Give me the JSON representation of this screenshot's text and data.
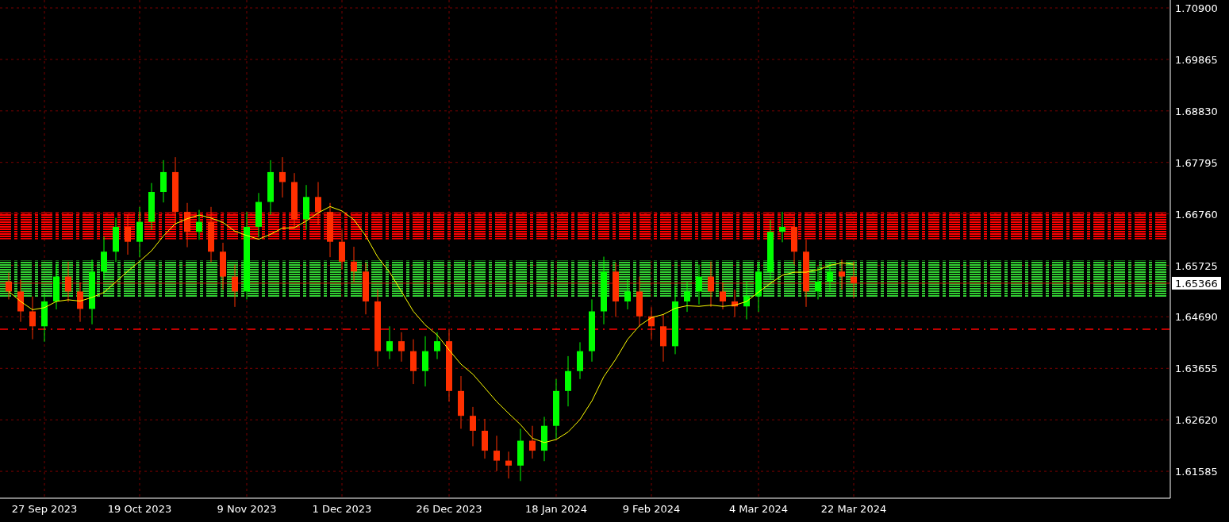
{
  "price_axis": {
    "labels": [
      "1.70900",
      "1.69865",
      "1.68830",
      "1.67795",
      "1.66760",
      "1.65725",
      "1.64690",
      "1.63655",
      "1.62620",
      "1.61585"
    ],
    "current_price": "1.65366"
  },
  "time_axis": {
    "labels": [
      "27 Sep 2023",
      "19 Oct 2023",
      "9 Nov 2023",
      "1 Dec 2023",
      "26 Dec 2023",
      "18 Jan 2024",
      "9 Feb 2024",
      "4 Mar 2024",
      "22 Mar 2024"
    ]
  }
}
